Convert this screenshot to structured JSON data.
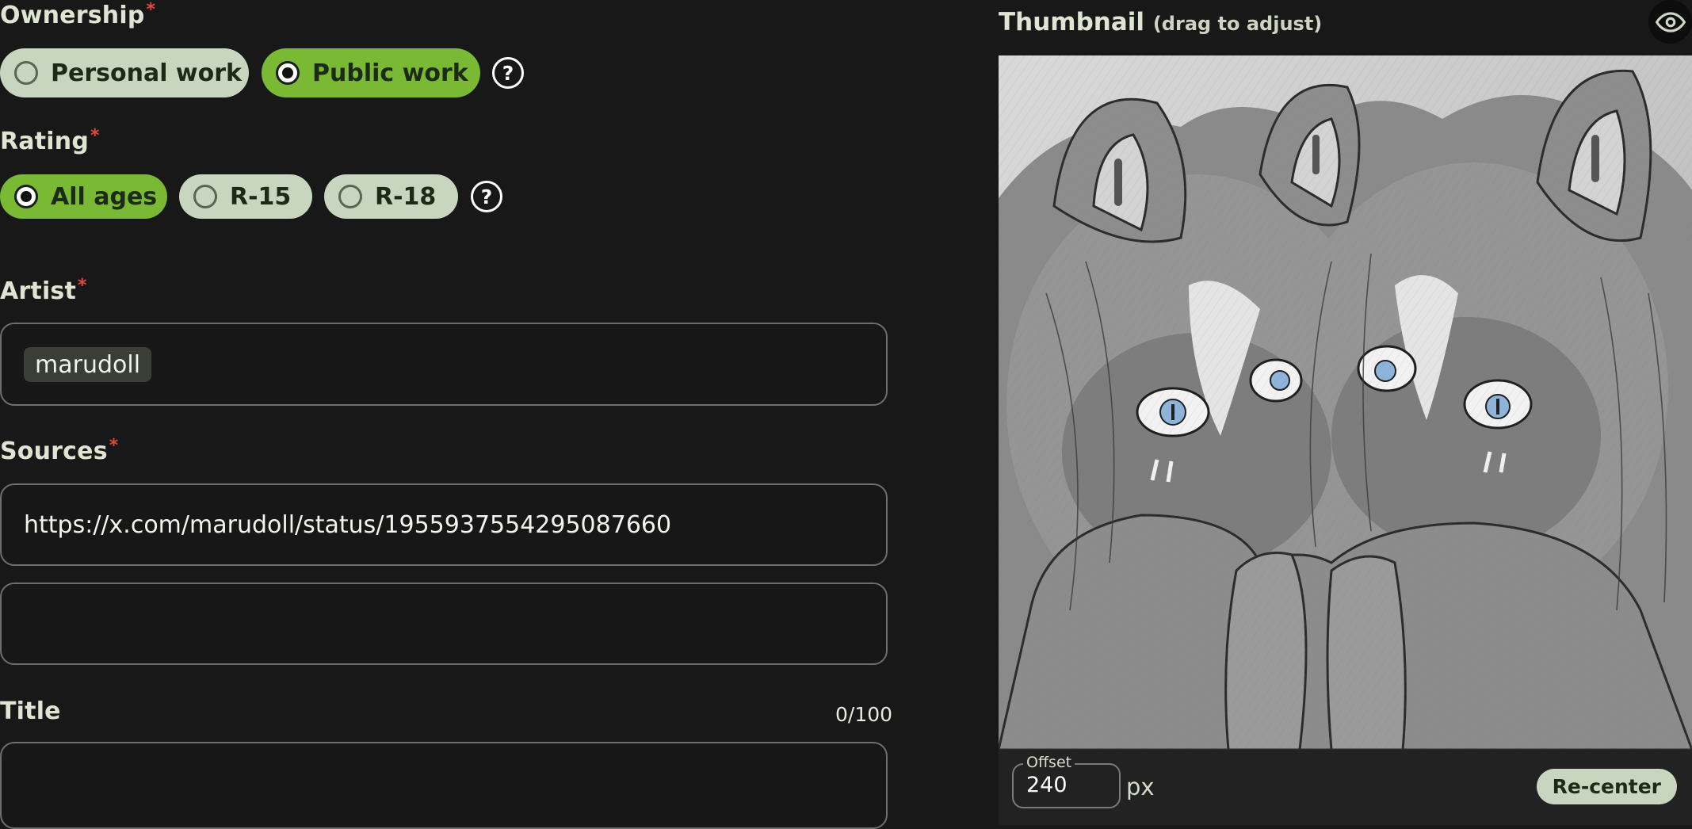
{
  "ownership": {
    "label": "Ownership",
    "required_mark": "*",
    "options": [
      {
        "label": "Personal work",
        "selected": false
      },
      {
        "label": "Public work",
        "selected": true
      }
    ],
    "help_glyph": "?"
  },
  "rating": {
    "label": "Rating",
    "required_mark": "*",
    "options": [
      {
        "label": "All ages",
        "selected": true
      },
      {
        "label": "R-15",
        "selected": false
      },
      {
        "label": "R-18",
        "selected": false
      }
    ],
    "help_glyph": "?"
  },
  "artist": {
    "label": "Artist",
    "required_mark": "*",
    "tags": [
      "marudoll"
    ]
  },
  "sources": {
    "label": "Sources",
    "required_mark": "*",
    "values": [
      "https://x.com/marudoll/status/1955937554295087660",
      ""
    ]
  },
  "title_field": {
    "label": "Title",
    "counter": "0/100",
    "value": ""
  },
  "thumbnail": {
    "title": "Thumbnail",
    "hint": "(drag to adjust)",
    "preview_icon": "eye-icon",
    "offset_label": "Offset",
    "offset_value": "240",
    "offset_unit": "px",
    "recenter_label": "Re-center"
  },
  "colors": {
    "background": "#181818",
    "accent_green": "#79b934",
    "pill_inactive": "#c8d6c0",
    "required_red": "#e2483e"
  }
}
